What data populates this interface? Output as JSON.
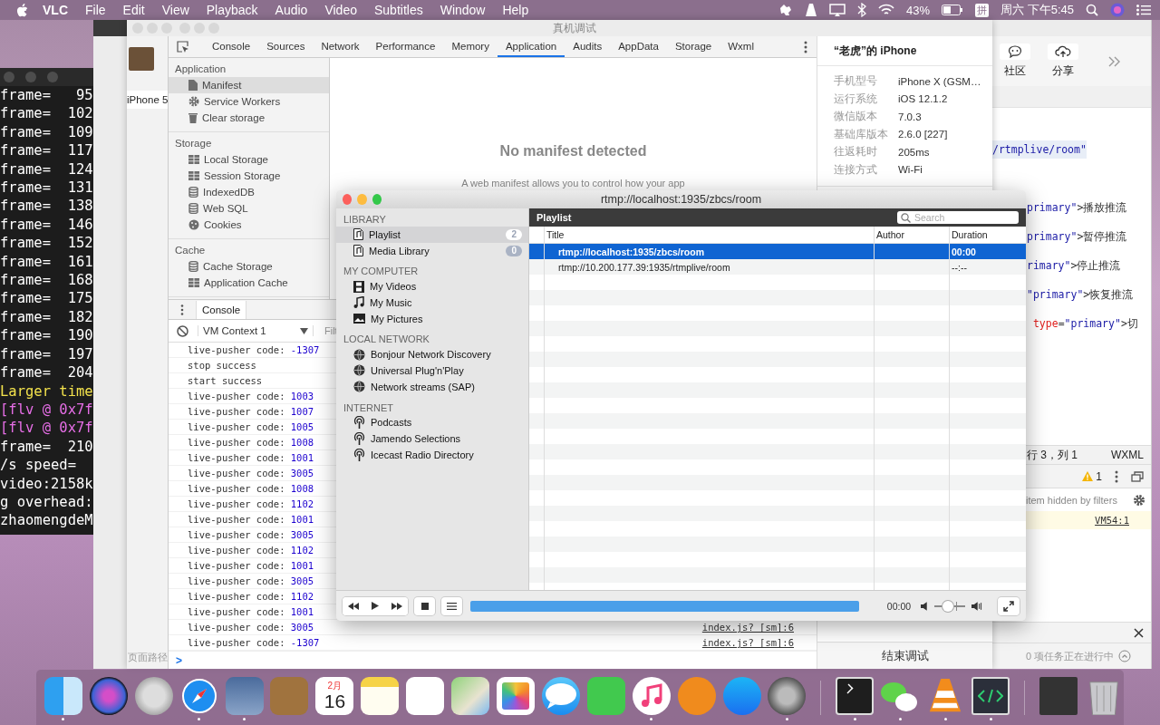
{
  "menubar": {
    "app": "VLC",
    "menus": [
      "File",
      "Edit",
      "View",
      "Playback",
      "Audio",
      "Video",
      "Subtitles",
      "Window",
      "Help"
    ],
    "battery": "43%",
    "input_method": "拼",
    "clock": "周六 下午5:45"
  },
  "terminal": {
    "lines": [
      {
        "text": "frame=   95",
        "color": "#ffffff"
      },
      {
        "text": "frame=  102",
        "color": "#ffffff"
      },
      {
        "text": "frame=  109",
        "color": "#ffffff"
      },
      {
        "text": "frame=  117",
        "color": "#ffffff"
      },
      {
        "text": "frame=  124",
        "color": "#ffffff"
      },
      {
        "text": "frame=  131",
        "color": "#ffffff"
      },
      {
        "text": "frame=  138",
        "color": "#ffffff"
      },
      {
        "text": "frame=  146",
        "color": "#ffffff"
      },
      {
        "text": "frame=  152",
        "color": "#ffffff"
      },
      {
        "text": "frame=  161",
        "color": "#ffffff"
      },
      {
        "text": "frame=  168",
        "color": "#ffffff"
      },
      {
        "text": "frame=  175",
        "color": "#ffffff"
      },
      {
        "text": "frame=  182",
        "color": "#ffffff"
      },
      {
        "text": "frame=  190",
        "color": "#ffffff"
      },
      {
        "text": "frame=  197",
        "color": "#ffffff"
      },
      {
        "text": "frame=  204",
        "color": "#ffffff"
      },
      {
        "text": "Larger time",
        "color": "#f2e14c"
      },
      {
        "text": "[flv @ 0x7f",
        "color": "#e66ee6"
      },
      {
        "text": "[flv @ 0x7f",
        "color": "#e66ee6"
      },
      {
        "text": "frame=  210",
        "color": "#ffffff"
      },
      {
        "text": "/s speed=",
        "color": "#ffffff"
      },
      {
        "text": "video:2158k",
        "color": "#ffffff"
      },
      {
        "text": "g overhead:",
        "color": "#ffffff"
      },
      {
        "text": "zhaomengdeM",
        "color": "#ffffff"
      }
    ]
  },
  "simulator": {
    "device": "iPhone 5",
    "page_path": "页面路径"
  },
  "devtools": {
    "title": "真机调试",
    "tabs": [
      {
        "label": "Console",
        "selected": false
      },
      {
        "label": "Sources",
        "selected": false
      },
      {
        "label": "Network",
        "selected": false
      },
      {
        "label": "Performance",
        "selected": false
      },
      {
        "label": "Memory",
        "selected": false
      },
      {
        "label": "Application",
        "selected": true
      },
      {
        "label": "Audits",
        "selected": false
      },
      {
        "label": "AppData",
        "selected": false
      },
      {
        "label": "Storage",
        "selected": false
      },
      {
        "label": "Wxml",
        "selected": false
      }
    ],
    "sidebar": [
      {
        "heading": "Application",
        "items": [
          {
            "label": "Manifest",
            "selected": true
          },
          {
            "label": "Service Workers",
            "selected": false
          },
          {
            "label": "Clear storage",
            "selected": false
          }
        ]
      },
      {
        "heading": "Storage",
        "items": [
          {
            "label": "Local Storage",
            "selected": false
          },
          {
            "label": "Session Storage",
            "selected": false
          },
          {
            "label": "IndexedDB",
            "selected": false
          },
          {
            "label": "Web SQL",
            "selected": false
          },
          {
            "label": "Cookies",
            "selected": false
          }
        ]
      },
      {
        "heading": "Cache",
        "items": [
          {
            "label": "Cache Storage",
            "selected": false
          },
          {
            "label": "Application Cache",
            "selected": false
          }
        ]
      }
    ],
    "manifest": {
      "heading": "No manifest detected",
      "text": "A web manifest allows you to control how your app"
    },
    "console": {
      "tab": "Console",
      "context": "VM Context 1",
      "filter_placeholder": "Filt",
      "prompt": ">",
      "lines": [
        {
          "text": "live-pusher code: ",
          "value": "-1307"
        },
        {
          "text": "stop success"
        },
        {
          "text": "start success"
        },
        {
          "text": "live-pusher code: ",
          "value": "1003"
        },
        {
          "text": "live-pusher code: ",
          "value": "1007"
        },
        {
          "text": "live-pusher code: ",
          "value": "1005"
        },
        {
          "text": "live-pusher code: ",
          "value": "1008"
        },
        {
          "text": "live-pusher code: ",
          "value": "1001"
        },
        {
          "text": "live-pusher code: ",
          "value": "3005"
        },
        {
          "text": "live-pusher code: ",
          "value": "1008"
        },
        {
          "text": "live-pusher code: ",
          "value": "1102"
        },
        {
          "text": "live-pusher code: ",
          "value": "1001"
        },
        {
          "text": "live-pusher code: ",
          "value": "3005"
        },
        {
          "text": "live-pusher code: ",
          "value": "1102"
        },
        {
          "text": "live-pusher code: ",
          "value": "1001"
        },
        {
          "text": "live-pusher code: ",
          "value": "3005"
        },
        {
          "text": "live-pusher code: ",
          "value": "1102"
        },
        {
          "text": "live-pusher code: ",
          "value": "1001"
        },
        {
          "text": "live-pusher code: ",
          "value": "3005",
          "source": "index.js? [sm]:6"
        },
        {
          "text": "live-pusher code: ",
          "value": "-1307",
          "source": "index.js? [sm]:6"
        }
      ]
    }
  },
  "device_info": {
    "title": "“老虎”的 iPhone",
    "rows": [
      {
        "key": "手机型号",
        "value": "iPhone X (GSM…"
      },
      {
        "key": "运行系统",
        "value": "iOS 12.1.2"
      },
      {
        "key": "微信版本",
        "value": "7.0.3"
      },
      {
        "key": "基础库版本",
        "value": "2.6.0 [227]"
      },
      {
        "key": "往返耗时",
        "value": "205ms"
      },
      {
        "key": "连接方式",
        "value": "Wi-Fi"
      }
    ],
    "end_button": "结束调试"
  },
  "ide": {
    "toolbar": [
      "社区",
      "分享"
    ],
    "code_lines": [
      {
        "highlighted": true,
        "parts": [
          {
            "kind": "string",
            "t": "/rtmplive/room\""
          }
        ]
      },
      {
        "highlighted": false,
        "parts": [
          {
            "kind": "string",
            "t": "primary\""
          },
          {
            "kind": "plain",
            "t": ">播放推流"
          }
        ]
      },
      {
        "highlighted": false,
        "parts": [
          {
            "kind": "string",
            "t": "primary\""
          },
          {
            "kind": "plain",
            "t": ">暂停推流"
          }
        ]
      },
      {
        "highlighted": false,
        "parts": [
          {
            "kind": "string",
            "t": "rimary\""
          },
          {
            "kind": "plain",
            "t": ">停止推流"
          }
        ]
      },
      {
        "highlighted": false,
        "parts": [
          {
            "kind": "string",
            "t": "\"primary\""
          },
          {
            "kind": "plain",
            "t": ">恢复推流"
          }
        ]
      },
      {
        "highlighted": false,
        "parts": [
          {
            "kind": "attr",
            "t": " type"
          },
          {
            "kind": "plain",
            "t": "="
          },
          {
            "kind": "string",
            "t": "\"primary\""
          },
          {
            "kind": "plain",
            "t": ">切"
          }
        ]
      }
    ],
    "status_position": "行 3，列 1",
    "language": "WXML",
    "warnings": "1",
    "filter_text": "item hidden by filters",
    "source_link": "VM54:1",
    "tasks": "0 项任务正在进行中"
  },
  "vlc": {
    "title": "rtmp://localhost:1935/zbcs/room",
    "sidebar": [
      {
        "heading": "LIBRARY",
        "items": [
          {
            "label": "Playlist",
            "badge": "2",
            "selected": true
          },
          {
            "label": "Media Library",
            "badge": "0",
            "selected": false
          }
        ]
      },
      {
        "heading": "MY COMPUTER",
        "items": [
          {
            "label": "My Videos",
            "selected": false
          },
          {
            "label": "My Music",
            "selected": false
          },
          {
            "label": "My Pictures",
            "selected": false
          }
        ]
      },
      {
        "heading": "LOCAL NETWORK",
        "items": [
          {
            "label": "Bonjour Network Discovery",
            "selected": false
          },
          {
            "label": "Universal Plug'n'Play",
            "selected": false
          },
          {
            "label": "Network streams (SAP)",
            "selected": false
          }
        ]
      },
      {
        "heading": "INTERNET",
        "items": [
          {
            "label": "Podcasts",
            "selected": false
          },
          {
            "label": "Jamendo Selections",
            "selected": false
          },
          {
            "label": "Icecast Radio Directory",
            "selected": false
          }
        ]
      }
    ],
    "panel_title": "Playlist",
    "search_placeholder": "Search",
    "columns": [
      "Title",
      "Author",
      "Duration"
    ],
    "rows": [
      {
        "title": "rtmp://localhost:1935/zbcs/room",
        "duration": "00:00",
        "selected": true
      },
      {
        "title": "rtmp://10.200.177.39:1935/rtmplive/room",
        "duration": "--:--",
        "selected": false
      }
    ],
    "progress": {
      "level": 1
    },
    "time": "00:00",
    "volume": {
      "level": 0.45
    }
  },
  "dock": [
    {
      "kind": "finder",
      "running": true
    },
    {
      "kind": "siri",
      "running": false
    },
    {
      "kind": "launchpad",
      "running": false
    },
    {
      "kind": "safari",
      "running": true
    },
    {
      "kind": "eagle",
      "running": true
    },
    {
      "kind": "notebook",
      "running": false
    },
    {
      "kind": "calendar",
      "running": false,
      "month": "2月",
      "day": "16"
    },
    {
      "kind": "notes",
      "running": false
    },
    {
      "kind": "reminders",
      "running": false
    },
    {
      "kind": "maps",
      "running": false
    },
    {
      "kind": "photos",
      "running": false
    },
    {
      "kind": "messages",
      "running": false
    },
    {
      "kind": "facetime",
      "running": false
    },
    {
      "kind": "itunes",
      "running": true
    },
    {
      "kind": "books",
      "running": false
    },
    {
      "kind": "appstore",
      "running": false
    },
    {
      "kind": "prefs",
      "running": true
    },
    {
      "kind": "sep"
    },
    {
      "kind": "terminal",
      "running": true
    },
    {
      "kind": "wechat",
      "running": true
    },
    {
      "kind": "vlc",
      "running": true
    },
    {
      "kind": "devtool",
      "running": true
    },
    {
      "kind": "sep"
    },
    {
      "kind": "windows",
      "running": false
    },
    {
      "kind": "trash",
      "running": false
    }
  ]
}
